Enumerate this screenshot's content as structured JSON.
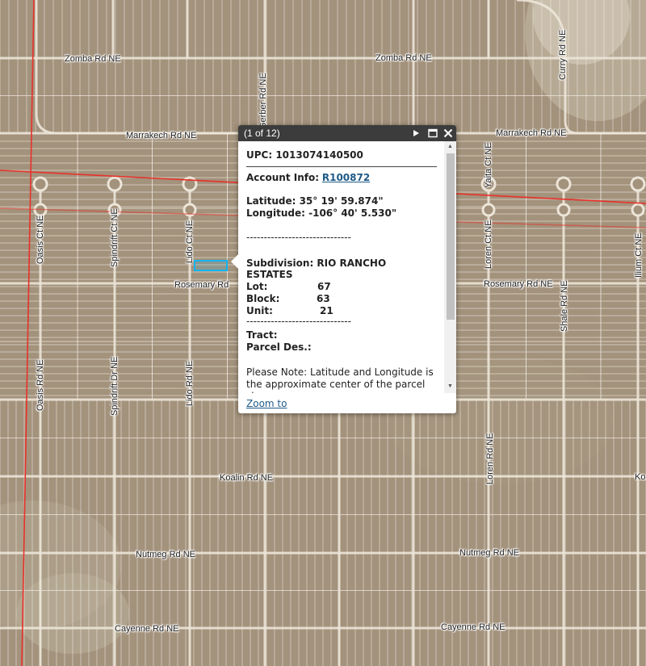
{
  "map": {
    "roads_horizontal": [
      "Zomba Rd NE",
      "Zomba Rd NE",
      "Marrakech Rd NE",
      "Marrakech Rd NE",
      "Rosemary Rd",
      "Rosemary Rd NE",
      "Koalin Rd NE",
      "Nutmeg Rd NE",
      "Nutmeg Rd NE",
      "Cayenne Rd NE",
      "Cayenne Rd NE"
    ],
    "roads_vertical": [
      "Gerber Rd NE",
      "Curry Rd NE",
      "Yaita Ct NE",
      "Oasis Ct NE",
      "Spindrift Ct NE",
      "Lido Ct NE",
      "Loren Ct NE",
      "Ilium Ct NE",
      "Shale Rd NE",
      "Oasis Rd NE",
      "Spindrift Dr NE",
      "Lido Rd NE",
      "Loren Rd NE"
    ],
    "partial_label": "Ko",
    "colors": {
      "terrain": "#a3927c",
      "parcel_lines": "#f2ede4",
      "boundary": "#e8312a",
      "highlight": "#14b4f0"
    }
  },
  "popup": {
    "title": "(1 of 12)",
    "upc": "UPC: 1013074140500",
    "account_label": "Account Info:",
    "account_link": "R100872",
    "latitude": "Latitude: 35° 19' 59.874\"",
    "longitude": "Longitude: -106° 40' 5.530\"",
    "separator": "------------------------------",
    "subdivision_line1": "Subdivision: RIO RANCHO",
    "subdivision_line2": "ESTATES",
    "lot_label": "Lot:",
    "lot_value": "67",
    "block_label": "Block:",
    "block_value": "63",
    "unit_label": "Unit:",
    "unit_value": "21",
    "tract_label": "Tract:",
    "parcel_des_label": "Parcel Des.:",
    "note_line1": "Please Note: Latitude and Longitude is",
    "note_line2": "the approximate center of the parcel",
    "note_line3": "shown",
    "zoom_to": "Zoom to",
    "icons": [
      "next-icon",
      "maximize-icon",
      "close-icon"
    ]
  }
}
